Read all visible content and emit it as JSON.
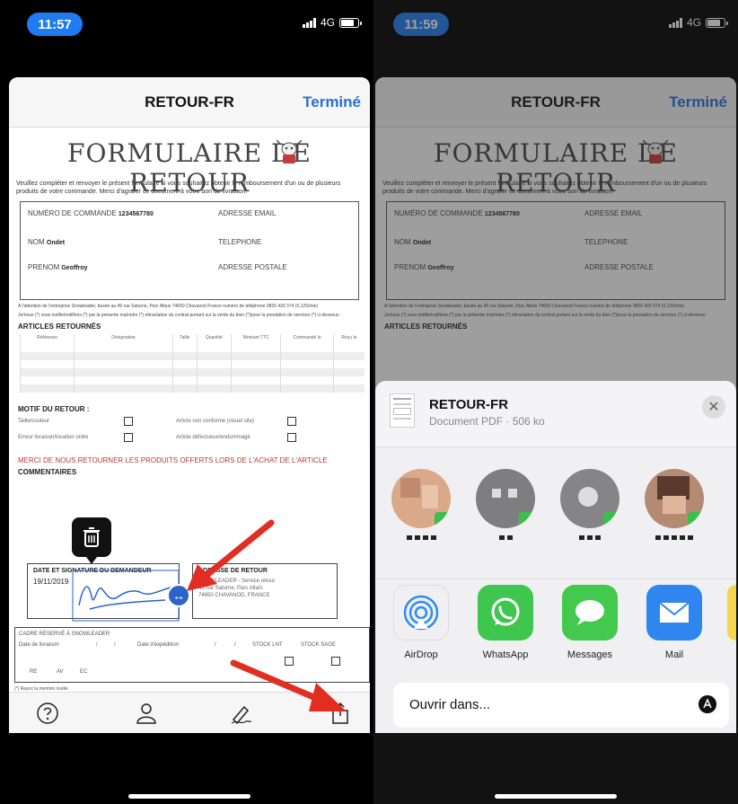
{
  "left": {
    "status_time": "11:57",
    "network": "4G",
    "nav_title": "RETOUR-FR",
    "nav_done": "Terminé",
    "doc": {
      "title": "FORMULAIRE DE RETOUR",
      "intro": "Veuillez compléter et renvoyer le présent formulaire si vous souhaitez obtenir le remboursement d'un ou de plusieurs produits de votre commande. Merci d'agrafer ce document à votre bon de livraison.",
      "order_label": "NUMÉRO DE COMMANDE",
      "order_value": "1234567780",
      "email_label": "ADRESSE EMAIL",
      "name_label": "NOM",
      "name_value": "Ondet",
      "phone_label": "TELEPHONE",
      "firstname_label": "PRENOM",
      "firstname_value": "Geoffroy",
      "postal_label": "ADRESSE POSTALE",
      "attention": "A l'attention de l'entreprise Snowleader, basée au 45 rue Saturne, Parc Altaïs 74650 Chavanod France numéro de téléphone 0820 420 374 (0,12€/min)",
      "notice": "Je/nous (*) vous notifie/notifions (*) par la présente ma/notre (*) rétractation du contrat portant sur la vente du bien (*)/pour la prestation de services (*) ci-dessous :",
      "articles_title": "ARTICLES RETOURNÉS",
      "columns": [
        "Référence",
        "Désignation",
        "Taille",
        "Quantité",
        "Montant TTC",
        "Commandé le",
        "Reçu le"
      ],
      "motif_title": "MOTIF DU RETOUR :",
      "motif_items": [
        "Taille/couleur",
        "Erreur livraison/location ordre",
        "Article non conforme (visuel site)",
        "Article défectueux/endommagé"
      ],
      "merci": "MERCI DE NOUS RETOURNER LES PRODUITS OFFERTS LORS DE L'ACHAT DE L'ARTICLE",
      "comments": "COMMENTAIRES",
      "sig_title": "DATE ET SIGNATURE DU DEMANDEUR",
      "sig_date": "19/11/2019",
      "address_title": "ADRESSE DE RETOUR",
      "address_lines": [
        "SNOWLEADER - Service retour",
        "45 rue Saturne, Parc Altaïs",
        "74650 CHAVANOD, FRANCE"
      ],
      "reserve_title": "CADRE RÉSERVÉ À SNOWLEADER",
      "reserve_date_recv": "Date de livraison",
      "reserve_date_exp": "Date d'expédition",
      "reserve_slash": "/",
      "reserve_stock1": "STOCK LNT",
      "reserve_stock2": "STOCK SAGE",
      "reserve_codes": [
        "RE",
        "AV",
        "EC"
      ],
      "footnote": "(*) Rayez la mention inutile"
    }
  },
  "right": {
    "status_time": "11:59",
    "network": "4G",
    "nav_title": "RETOUR-FR",
    "nav_done": "Terminé",
    "share": {
      "file_name": "RETOUR-FR",
      "file_sub": "Document PDF · 506 ko",
      "close_glyph": "✕",
      "apps": [
        {
          "label": "AirDrop",
          "color": "#ffffff"
        },
        {
          "label": "WhatsApp",
          "color": "#3ec64f"
        },
        {
          "label": "Messages",
          "color": "#43c94e"
        },
        {
          "label": "Mail",
          "color": "#2f86f0"
        }
      ],
      "open_in": "Ouvrir dans..."
    }
  },
  "colors": {
    "ios_blue": "#2a6fd6",
    "status_pill": "#1e7cf2",
    "red_arrow": "#e22d22",
    "merci_red": "#b83a2d"
  }
}
